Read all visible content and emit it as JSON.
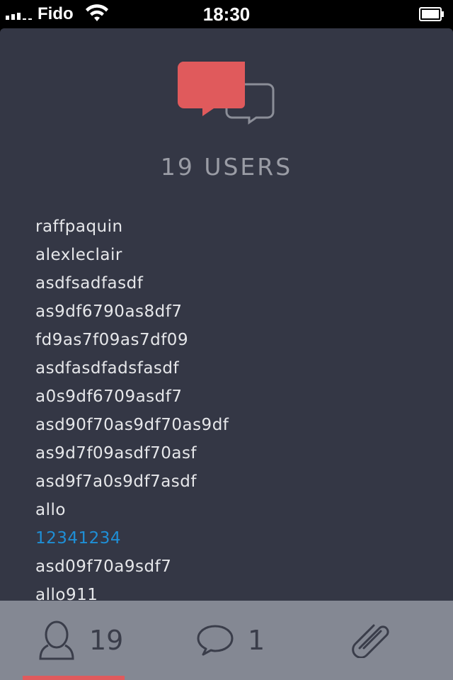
{
  "status_bar": {
    "carrier": "Fido",
    "time": "18:30",
    "icons": [
      "signal-icon",
      "wifi-icon",
      "battery-icon"
    ]
  },
  "header": {
    "icon": "chat-bubbles-icon",
    "title": "19 USERS"
  },
  "users": [
    "raffpaquin",
    "alexleclair",
    "asdfsadfasdf",
    "as9df6790as8df7",
    "fd9as7f09as7df09",
    "asdfasdfadsfasdf",
    "a0s9df6709asdf7",
    "asd90f70as9df70as9df",
    "as9d7f09asdf70asf",
    "asd9f7a0s9df7asdf",
    "allo",
    "12341234",
    "asd09f70a9sdf7",
    "allo911"
  ],
  "tab_bar": {
    "users_count": "19",
    "chat_count": "1",
    "icons": [
      "user-icon",
      "speech-bubble-icon",
      "paperclip-icon"
    ]
  },
  "colors": {
    "background": "#343745",
    "accent": "#e05a5c",
    "link": "#1f8fd6",
    "tab_bar": "#848893"
  }
}
